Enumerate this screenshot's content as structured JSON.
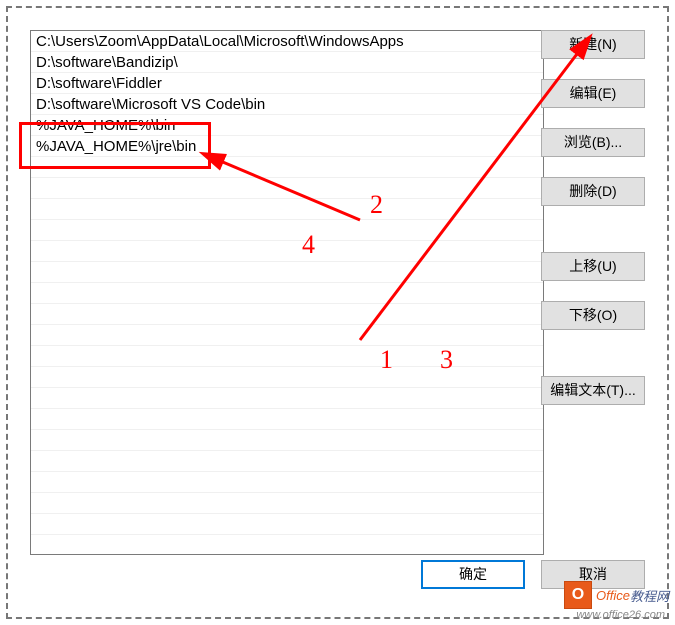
{
  "paths": [
    "C:\\Users\\Zoom\\AppData\\Local\\Microsoft\\WindowsApps",
    "D:\\software\\Bandizip\\",
    "D:\\software\\Fiddler",
    "D:\\software\\Microsoft VS Code\\bin",
    "%JAVA_HOME%\\bin",
    "%JAVA_HOME%\\jre\\bin"
  ],
  "buttons": {
    "new": "新建(N)",
    "edit": "编辑(E)",
    "browse": "浏览(B)...",
    "delete": "删除(D)",
    "moveUp": "上移(U)",
    "moveDown": "下移(O)",
    "editText": "编辑文本(T)...",
    "ok": "确定",
    "cancel": "取消"
  },
  "annotations": {
    "n1": "1",
    "n2": "2",
    "n3": "3",
    "n4": "4"
  },
  "watermark": {
    "logoLetter": "O",
    "brand1": "Office",
    "brand2": "教程网",
    "url": "www.office26.com"
  }
}
